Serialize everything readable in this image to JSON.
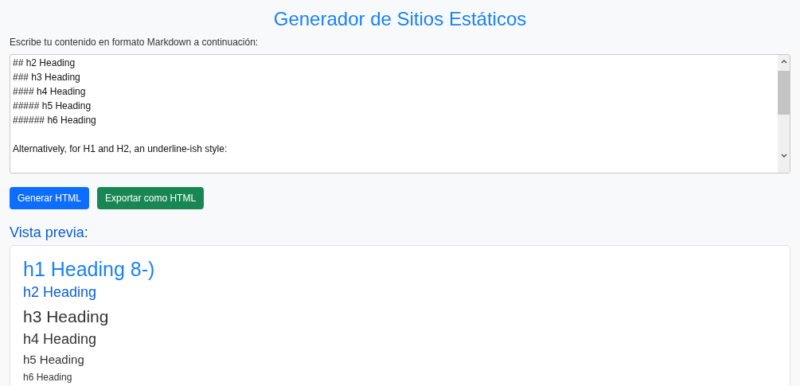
{
  "page_title": "Generador de Sitios Estáticos",
  "editor": {
    "label": "Escribe tu contenido en formato Markdown a continuación:",
    "paragraphs": [
      [
        "## h2 Heading",
        "### h3 Heading",
        "#### h4 Heading",
        "##### h5 Heading",
        "###### h6 Heading"
      ],
      [
        "Alternatively, for H1 and H2, an underline-ish style:"
      ]
    ]
  },
  "buttons": [
    {
      "label": "Generar HTML",
      "kind": "primary"
    },
    {
      "label": "Exportar como HTML",
      "kind": "success"
    }
  ],
  "preview": {
    "title": "Vista previa:",
    "headings": [
      {
        "kind": "h1",
        "text": "h1 Heading 8-)"
      },
      {
        "kind": "h2",
        "text": "h2 Heading"
      },
      {
        "kind": "h3",
        "text": "h3 Heading"
      },
      {
        "kind": "h4",
        "text": "h4 Heading"
      },
      {
        "kind": "h5",
        "text": "h5 Heading"
      },
      {
        "kind": "h6",
        "text": "h6 Heading"
      }
    ]
  }
}
